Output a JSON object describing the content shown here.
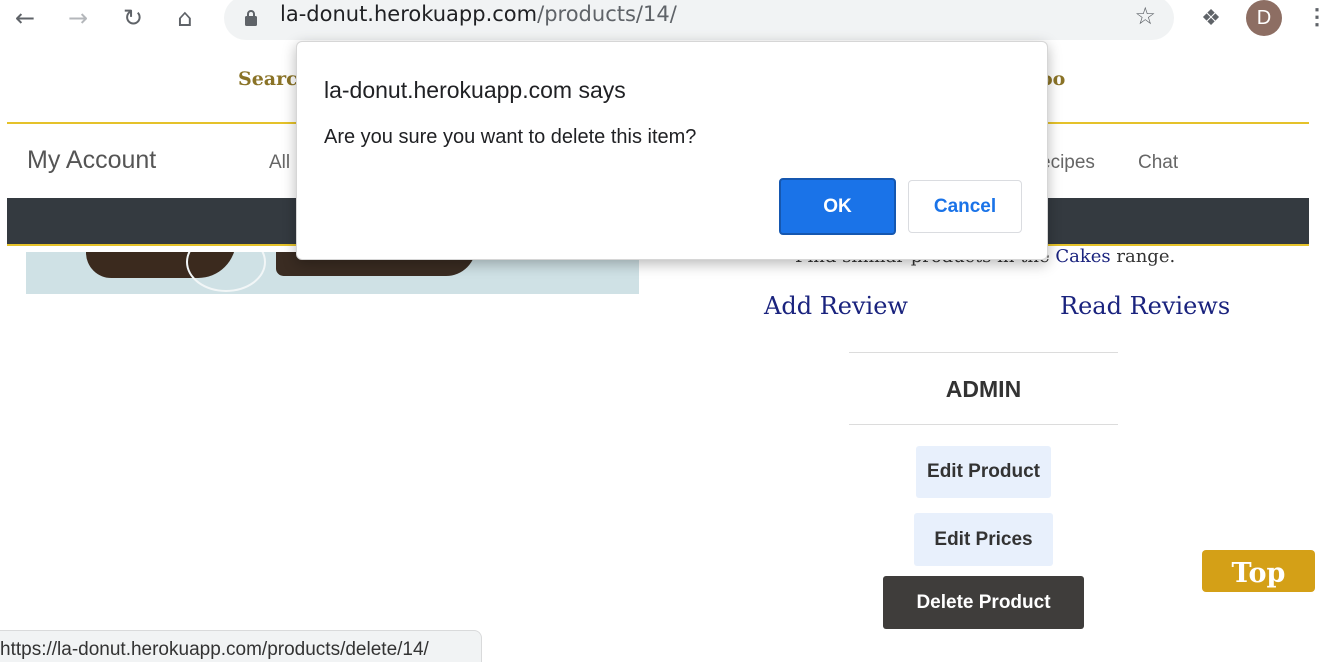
{
  "browser": {
    "back_icon": "arrow-left-icon",
    "forward_icon": "arrow-right-icon",
    "reload_icon": "reload-icon",
    "home_icon": "home-icon",
    "url_host": "la-donut.herokuapp.com",
    "url_path": "/products/14/",
    "lock_icon": "lock-icon",
    "bookmark_icon": "star-icon",
    "extensions_icon": "puzzle-icon",
    "avatar_letter": "D",
    "menu_icon": "kebab-menu-icon"
  },
  "site": {
    "search_label": "Search",
    "right_link_fragment": "oo",
    "brand": "My Account",
    "nav_all": "All",
    "nav_recipes": "ecipes",
    "nav_chat": "Chat"
  },
  "product": {
    "similar_prefix": "Find similar products in the ",
    "category": "Cakes",
    "similar_suffix": " range.",
    "add_review": "Add Review",
    "read_reviews": "Read Reviews"
  },
  "admin": {
    "heading": "ADMIN",
    "edit_product": "Edit Product",
    "edit_prices": "Edit Prices",
    "delete_product": "Delete Product"
  },
  "top_button": "Top",
  "status_bar_url": "https://la-donut.herokuapp.com/products/delete/14/",
  "dialog": {
    "title": "la-donut.herokuapp.com says",
    "message": "Are you sure you want to delete this item?",
    "ok_label": "OK",
    "cancel_label": "Cancel"
  },
  "colors": {
    "accent_gold": "#e5c22a",
    "dialog_ok_blue": "#1a73e8",
    "link_navy": "#1a237e",
    "dark_band": "#343a40"
  }
}
